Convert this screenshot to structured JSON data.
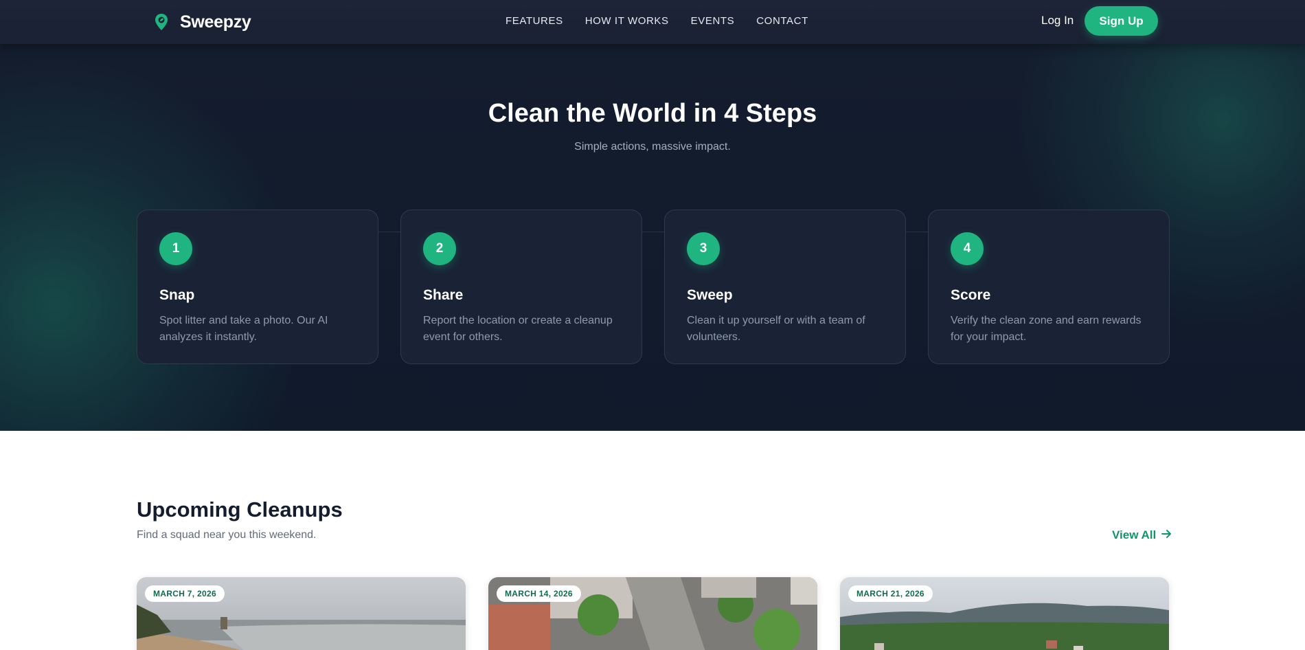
{
  "brand": {
    "name": "Sweepzy",
    "accent": "#1fb480",
    "logo_icon": "map-pin-leaf-icon"
  },
  "nav": {
    "links": [
      "FEATURES",
      "HOW IT WORKS",
      "EVENTS",
      "CONTACT"
    ],
    "login_label": "Log In",
    "signup_label": "Sign Up"
  },
  "hero": {
    "title": "Clean the World in 4 Steps",
    "subtitle": "Simple actions, massive impact.",
    "steps": [
      {
        "number": "1",
        "title": "Snap",
        "description": "Spot litter and take a photo. Our AI analyzes it instantly."
      },
      {
        "number": "2",
        "title": "Share",
        "description": "Report the location or create a cleanup event for others."
      },
      {
        "number": "3",
        "title": "Sweep",
        "description": "Clean it up yourself or with a team of volunteers."
      },
      {
        "number": "4",
        "title": "Score",
        "description": "Verify the clean zone and earn rewards for your impact."
      }
    ]
  },
  "upcoming": {
    "title": "Upcoming Cleanups",
    "subtitle": "Find a squad near you this weekend.",
    "view_all_label": "View All",
    "view_all_icon": "arrow-right-icon",
    "events": [
      {
        "date": "MARCH 7, 2026",
        "image": "beach-shoreline-photo"
      },
      {
        "date": "MARCH 14, 2026",
        "image": "aerial-town-street-photo"
      },
      {
        "date": "MARCH 21, 2026",
        "image": "hillside-town-photo"
      }
    ]
  }
}
